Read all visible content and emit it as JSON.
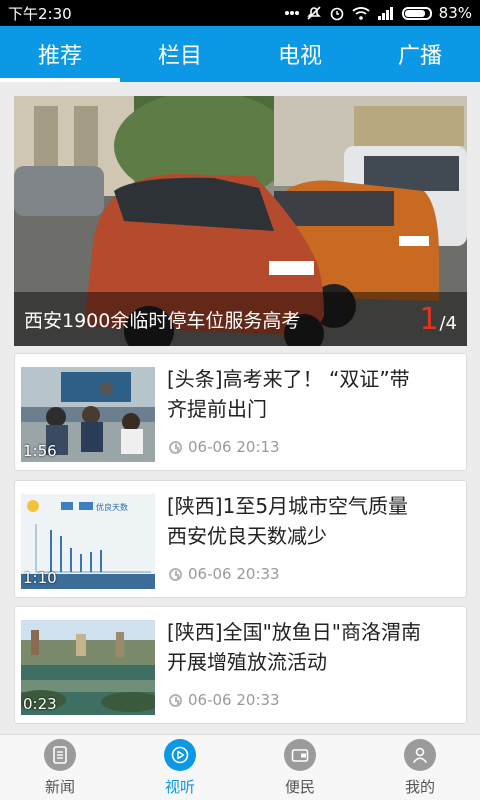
{
  "status": {
    "time": "下午2:30",
    "battery": "83%"
  },
  "tabs": [
    {
      "label": "推荐",
      "active": true
    },
    {
      "label": "栏目",
      "active": false
    },
    {
      "label": "电视",
      "active": false
    },
    {
      "label": "广播",
      "active": false
    }
  ],
  "hero": {
    "title": "西安1900余临时停车位服务高考",
    "current": "1",
    "total": "/4"
  },
  "news": [
    {
      "title_line1": "[头条]高考来了！ “双证”带",
      "title_line2": "齐提前出门",
      "duration": "1:56",
      "time": "06-06 20:13"
    },
    {
      "title_line1": "[陕西]1至5月城市空气质量",
      "title_line2": "西安优良天数减少",
      "duration": "1:10",
      "time": "06-06 20:33",
      "thumb_text": "优良天数"
    },
    {
      "title_line1": "[陕西]全国\"放鱼日\"商洛渭南",
      "title_line2": "开展增殖放流活动",
      "duration": "0:23",
      "time": "06-06 20:33"
    }
  ],
  "bottom_nav": [
    {
      "label": "新闻",
      "icon": "news-icon",
      "active": false
    },
    {
      "label": "视听",
      "icon": "play-icon",
      "active": true
    },
    {
      "label": "便民",
      "icon": "wallet-icon",
      "active": false
    },
    {
      "label": "我的",
      "icon": "user-icon",
      "active": false
    }
  ],
  "colors": {
    "accent": "#0b99e6",
    "counter": "#e8311f"
  }
}
